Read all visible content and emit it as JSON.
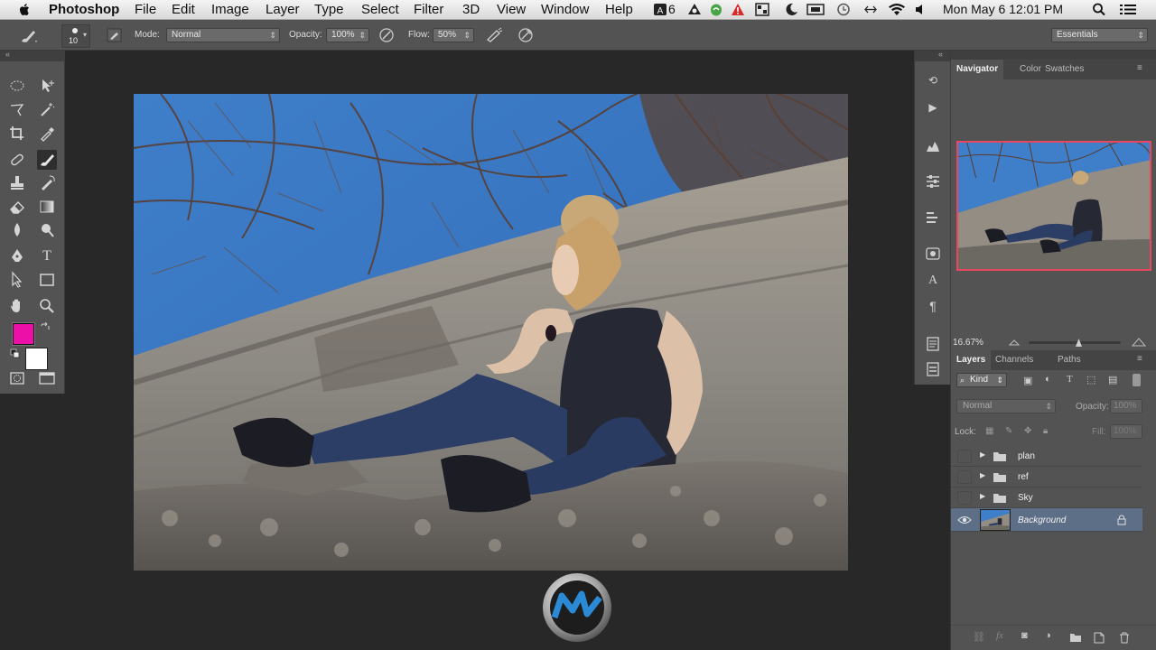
{
  "menubar": {
    "app": "Photoshop",
    "items": [
      "File",
      "Edit",
      "Image",
      "Layer",
      "Type",
      "Select",
      "Filter",
      "3D",
      "View",
      "Window",
      "Help"
    ],
    "adobe_count": "6",
    "datetime": "Mon May 6  12:01 PM"
  },
  "options": {
    "brush_size": "10",
    "mode_label": "Mode:",
    "mode_value": "Normal",
    "opacity_label": "Opacity:",
    "opacity_value": "100%",
    "flow_label": "Flow:",
    "flow_value": "50%",
    "workspace": "Essentials"
  },
  "colors": {
    "foreground": "#ec0fa8",
    "background": "#ffffff"
  },
  "navigator": {
    "tabs": [
      "Navigator",
      "Color",
      "Swatches"
    ],
    "active_tab": "Navigator",
    "zoom": "16.67%",
    "zoom_fraction": 0.55
  },
  "layers_panel": {
    "tabs": [
      "Layers",
      "Channels",
      "Paths"
    ],
    "active_tab": "Layers",
    "filter_kind": "Kind",
    "blend_mode": "Normal",
    "opacity_label": "Opacity:",
    "opacity_value": "100%",
    "lock_label": "Lock:",
    "fill_label": "Fill:",
    "fill_value": "100%",
    "layers": [
      {
        "name": "plan",
        "type": "group",
        "visible": false
      },
      {
        "name": "ref",
        "type": "group",
        "visible": false
      },
      {
        "name": "Sky",
        "type": "group",
        "visible": false
      },
      {
        "name": "Background",
        "type": "image",
        "visible": true,
        "locked": true
      }
    ]
  }
}
